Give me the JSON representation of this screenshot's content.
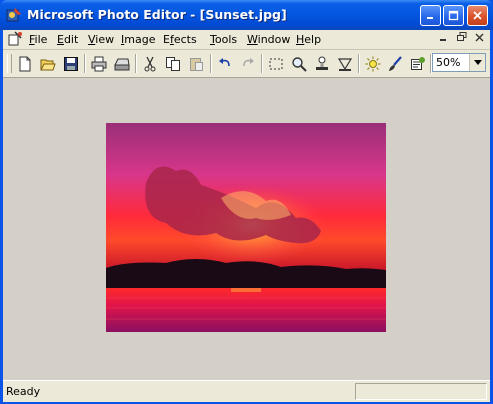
{
  "window": {
    "title": "Microsoft Photo Editor - [Sunset.jpg]",
    "controls": [
      "minimize",
      "maximize",
      "close"
    ]
  },
  "menu": {
    "items": [
      {
        "label": "File",
        "accel": "F",
        "rest": "ile"
      },
      {
        "label": "Edit",
        "accel": "E",
        "rest": "dit"
      },
      {
        "label": "View",
        "accel": "V",
        "rest": "iew"
      },
      {
        "label": "Image",
        "accel": "I",
        "rest": "mage"
      },
      {
        "label": "Effects",
        "accel": "f",
        "pre": "E",
        "rest": "ects"
      },
      {
        "label": "Tools",
        "accel": "T",
        "rest": "ools"
      },
      {
        "label": "Window",
        "accel": "W",
        "rest": "indow"
      },
      {
        "label": "Help",
        "accel": "H",
        "rest": "elp"
      }
    ],
    "mdi_controls": [
      "minimize",
      "restore",
      "close"
    ]
  },
  "toolbar": {
    "tools": [
      "new-icon",
      "open-icon",
      "save-icon",
      "print-icon",
      "scan-icon",
      "cut-icon",
      "copy-icon",
      "paste-icon",
      "undo-icon",
      "redo-icon",
      "select-icon",
      "zoom-icon",
      "stamp-icon",
      "balance-icon",
      "brightness-icon",
      "paintbrush-icon",
      "properties-icon"
    ],
    "zoom_value": "50%"
  },
  "document": {
    "image_name": "Sunset.jpg"
  },
  "status": {
    "text": "Ready"
  },
  "colors": {
    "titlebar": "#0456e0",
    "workspace": "#d4d0c8",
    "close_button": "#d9532c"
  }
}
